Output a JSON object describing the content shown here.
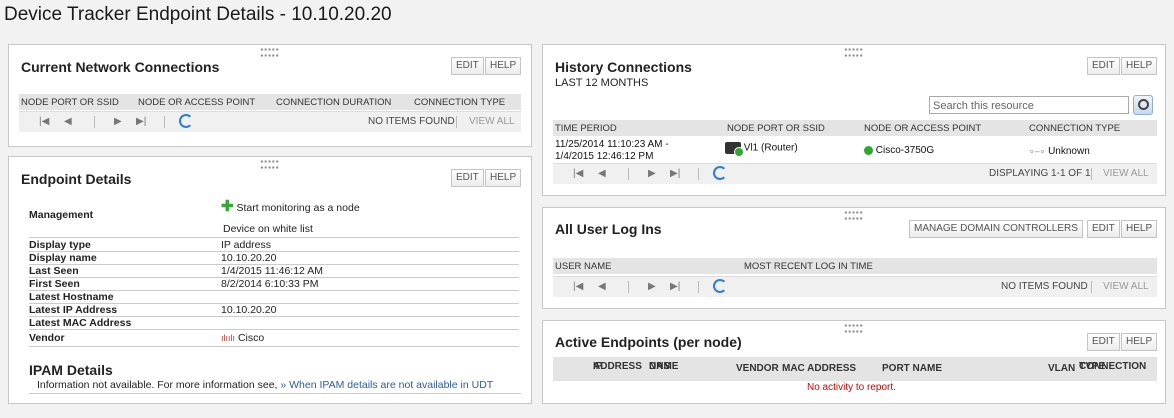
{
  "page_title": "Device Tracker Endpoint Details - 10.10.20.20",
  "buttons": {
    "edit": "EDIT",
    "help": "HELP",
    "manage_dc": "MANAGE DOMAIN CONTROLLERS"
  },
  "current_connections": {
    "title": "Current Network Connections",
    "columns": [
      "NODE PORT OR SSID",
      "NODE OR ACCESS POINT",
      "CONNECTION DURATION",
      "CONNECTION TYPE"
    ],
    "status": "NO ITEMS FOUND",
    "view_all": "VIEW ALL"
  },
  "endpoint_details": {
    "title": "Endpoint Details",
    "management_label": "Management",
    "start_monitoring": "Start monitoring as a node",
    "white_list": "Device on white list",
    "rows": [
      {
        "label": "Display type",
        "value": "IP address"
      },
      {
        "label": "Display name",
        "value": "10.10.20.20"
      },
      {
        "label": "Last Seen",
        "value": "1/4/2015 11:46:12 AM"
      },
      {
        "label": "First Seen",
        "value": "8/2/2014 6:10:33 PM"
      },
      {
        "label": "Latest Hostname",
        "value": ""
      },
      {
        "label": "Latest IP Address",
        "value": "10.10.20.20"
      },
      {
        "label": "Latest MAC Address",
        "value": ""
      },
      {
        "label": "Vendor",
        "value": "Cisco"
      }
    ]
  },
  "ipam": {
    "title": "IPAM Details",
    "text": "Information not available. For more information see,",
    "link": "» When IPAM details are not available in UDT"
  },
  "history": {
    "title": "History Connections",
    "subtitle": "LAST 12 MONTHS",
    "search_placeholder": "Search this resource",
    "columns": [
      "TIME PERIOD",
      "NODE PORT OR SSID",
      "NODE OR ACCESS POINT",
      "CONNECTION TYPE"
    ],
    "row": {
      "period_1": "11/25/2014 11:10:23 AM -",
      "period_2": "1/4/2015 12:46:12 PM",
      "port": "Vl1 (Router)",
      "node": "Cisco-3750G",
      "type": "Unknown"
    },
    "status": "DISPLAYING 1-1 OF 1",
    "view_all": "VIEW ALL"
  },
  "logins": {
    "title": "All User Log Ins",
    "columns": [
      "USER NAME",
      "MOST RECENT LOG IN TIME"
    ],
    "status": "NO ITEMS FOUND",
    "view_all": "VIEW ALL"
  },
  "active_endpoints": {
    "title": "Active Endpoints (per node)",
    "columns": {
      "ip_1": "IP",
      "ip_2": "ADDRESS",
      "dns_1": "DNS",
      "dns_2": "NAME",
      "vendor": "VENDOR",
      "mac": "MAC ADDRESS",
      "port": "PORT NAME",
      "vlan": "VLAN",
      "conn_1": "CONNECTION",
      "conn_2": "TYPE"
    },
    "no_activity": "No activity to report."
  }
}
